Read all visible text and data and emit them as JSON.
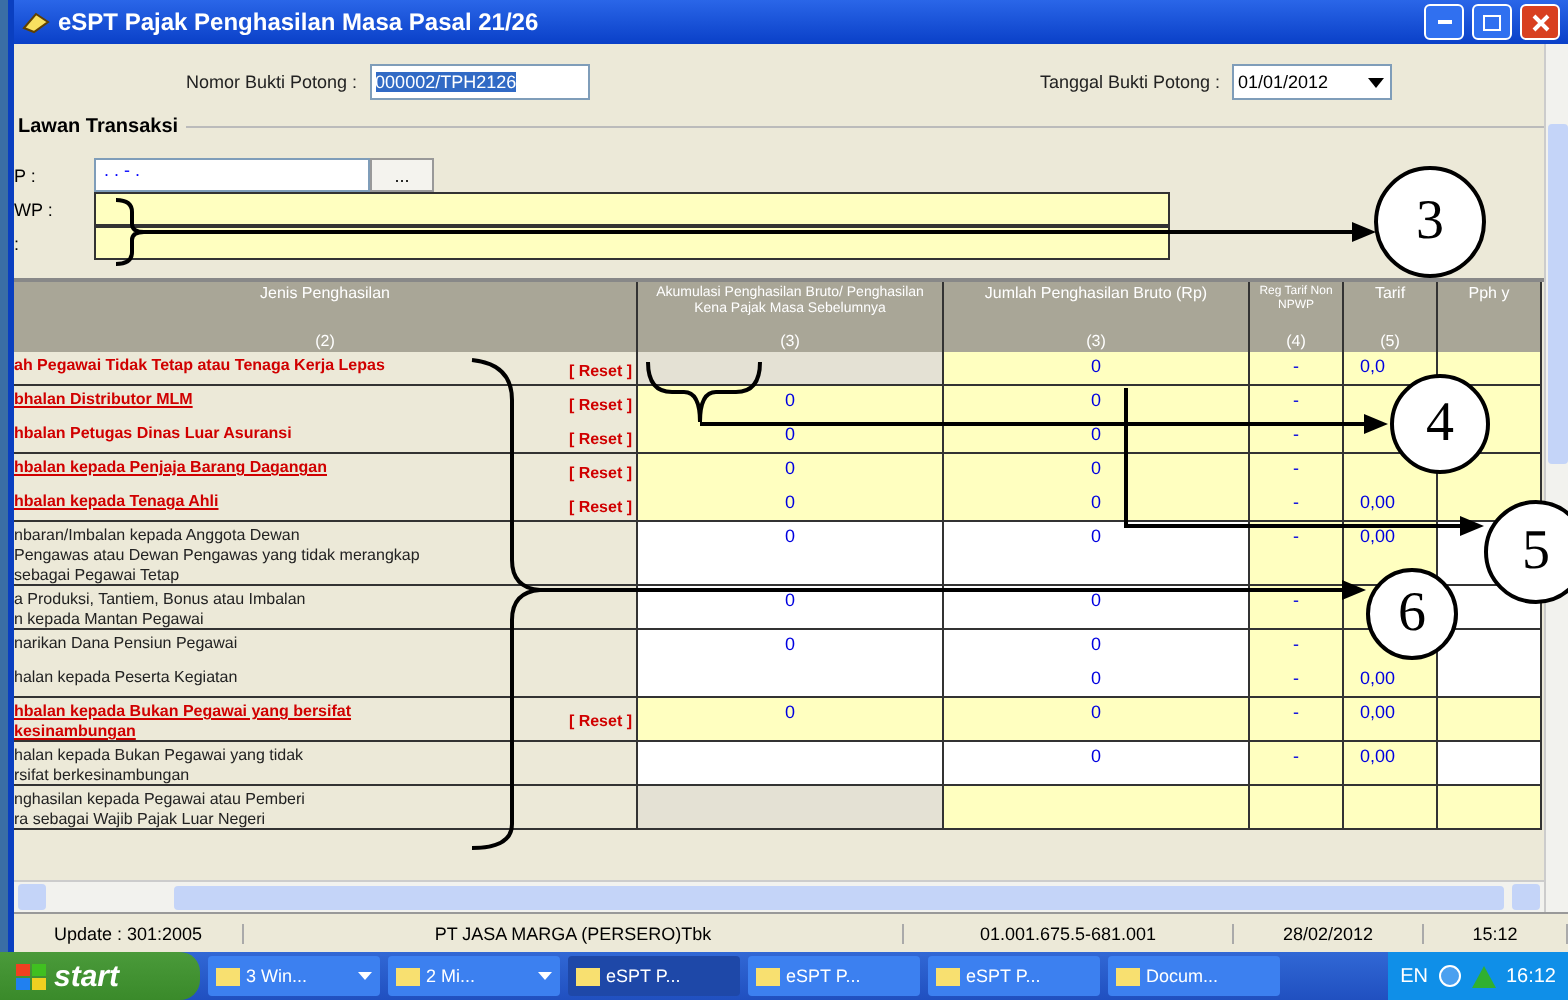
{
  "window": {
    "title": "eSPT Pajak Penghasilan Masa Pasal 21/26"
  },
  "form": {
    "nomor": {
      "label": "Nomor Bukti Potong :",
      "value": "000002/TPH2126"
    },
    "tanggal": {
      "label": "Tanggal Bukti Potong :",
      "value": "01/01/2012"
    }
  },
  "lawan_transaksi": {
    "title": "Lawan Transaksi",
    "fields": [
      {
        "label": "P  :",
        "value": ". . - .",
        "browse": "..."
      },
      {
        "label": "WP :"
      },
      {
        "label": ":"
      }
    ]
  },
  "table": {
    "columns": [
      {
        "label": "Jenis Penghasilan",
        "num": "(2)"
      },
      {
        "label": "Akumulasi Penghasilan Bruto/ Penghasilan Kena Pajak Masa Sebelumnya",
        "num": "(3)"
      },
      {
        "label": "Jumlah Penghasilan Bruto (Rp)",
        "num": "(3)"
      },
      {
        "label": "Reg Tarif Non NPWP",
        "num": "(4)"
      },
      {
        "label": "Tarif",
        "num": "(5)"
      },
      {
        "label": "Pph y"
      }
    ],
    "rows": [
      {
        "name": "ah Pegawai Tidak Tetap atau Tenaga Kerja Lepas",
        "kind": "editable",
        "link": false,
        "reset": "[ Reset ]",
        "bruto": "0",
        "reg": "-",
        "tarif": "0,0"
      },
      {
        "name": "bhalan Distributor MLM",
        "kind": "editable",
        "link": true,
        "reset": "[ Reset ]",
        "akumulasi": "0",
        "bruto": "0",
        "reg": "-"
      },
      {
        "name": "hbalan Petugas Dinas Luar Asuransi",
        "kind": "editable",
        "link": false,
        "reset": "[ Reset ]",
        "akumulasi": "0",
        "bruto": "0",
        "reg": "-"
      },
      {
        "name": "hbalan kepada Penjaja Barang Dagangan",
        "kind": "editable",
        "link": true,
        "reset": "[ Reset ]",
        "akumulasi": "0",
        "bruto": "0",
        "reg": "-"
      },
      {
        "name": "hbalan kepada Tenaga Ahli",
        "kind": "editable",
        "link": true,
        "reset": "[ Reset ]",
        "akumulasi": "0",
        "bruto": "0",
        "reg": "-",
        "tarif": "0,00"
      },
      {
        "name": "nbaran/Imbalan kepada Anggota Dewan\nPengawas atau Dewan Pengawas yang tidak merangkap\nsebagai Pegawai Tetap",
        "kind": "plain",
        "link": false,
        "akumulasi": "0",
        "bruto": "0",
        "reg": "-",
        "tarif": "0,00"
      },
      {
        "name": "a Produksi, Tantiem, Bonus atau Imbalan\nn kepada Mantan Pegawai",
        "kind": "plain",
        "link": false,
        "akumulasi": "0",
        "bruto": "0",
        "reg": "-"
      },
      {
        "name": "narikan Dana Pensiun Pegawai",
        "kind": "plain",
        "link": false,
        "akumulasi": "0",
        "bruto": "0",
        "reg": "-"
      },
      {
        "name": "halan kepada Peserta Kegiatan",
        "kind": "plain",
        "link": false,
        "bruto": "0",
        "reg": "-",
        "tarif": "0,00"
      },
      {
        "name": "hbalan kepada Bukan Pegawai yang bersifat\nkesinambungan",
        "kind": "editable",
        "link": true,
        "reset": "[ Reset ]",
        "akumulasi": "0",
        "bruto": "0",
        "reg": "-",
        "tarif": "0,00"
      },
      {
        "name": "halan kepada Bukan Pegawai yang tidak\nrsifat berkesinambungan",
        "kind": "plain",
        "link": false,
        "bruto": "0",
        "reg": "-",
        "tarif": "0,00"
      },
      {
        "name": "nghasilan kepada Pegawai atau Pemberi\nra sebagai Wajib Pajak Luar Negeri",
        "kind": "editable",
        "link": false
      }
    ]
  },
  "status_bar": [
    "Update : 301:2005",
    "PT JASA MARGA (PERSERO)Tbk",
    "01.001.675.5-681.001",
    "28/02/2012",
    "15:12"
  ],
  "taskbar": {
    "start": "start",
    "items": [
      {
        "label": "3 Win...",
        "active": false,
        "caret": true
      },
      {
        "label": "2 Mi...",
        "active": false,
        "caret": true
      },
      {
        "label": "eSPT P...",
        "active": true,
        "caret": false
      },
      {
        "label": "eSPT P...",
        "active": false,
        "caret": false
      },
      {
        "label": "eSPT P...",
        "active": false,
        "caret": false
      },
      {
        "label": "Docum...",
        "active": false,
        "caret": false
      }
    ],
    "lang": "EN",
    "clock": "16:12"
  },
  "annotations": [
    "3",
    "4",
    "5",
    "6"
  ]
}
